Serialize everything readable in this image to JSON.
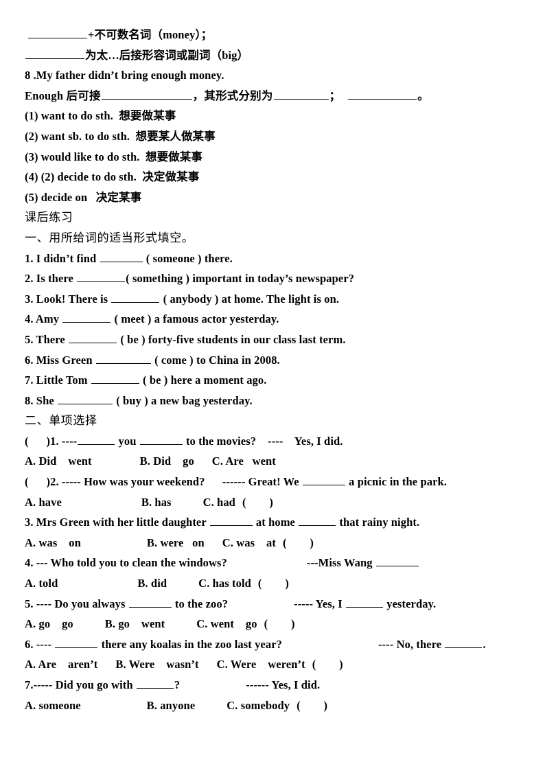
{
  "document": {
    "title": "English grammar worksheet page",
    "text_color": "#000000",
    "background_color": "#ffffff"
  },
  "notes": {
    "line1_suffix": "+不可数名词（money）；",
    "line2_suffix": "为太…后接形容词或副词（big）",
    "line3": "8 .My father didn’t bring enough money.",
    "line4_a": "Enough 后可接",
    "line4_b": "，其形式分别为",
    "line4_c": "；",
    "line4_d": "。",
    "items": [
      "(1) want to do sth.  想要做某事",
      "(2) want sb. to do sth.  想要某人做某事",
      "(3) would like to do sth.  想要做某事",
      "(4) (2) decide to do sth.  决定做某事",
      "(5) decide on   决定某事"
    ],
    "practice_heading": "课后练习"
  },
  "section_one": {
    "heading": "一、用所给词的适当形式填空。",
    "questions": [
      {
        "num": "1.",
        "before": " I didn’t find ",
        "after": " ( someone ) there."
      },
      {
        "num": "2.",
        "before": " Is there ",
        "after": "( something ) important in today’s newspaper?"
      },
      {
        "num": "3.",
        "before": " Look! There is ",
        "after": " ( anybody ) at home. The light is on."
      },
      {
        "num": "4.",
        "before": " Amy ",
        "after": " ( meet ) a famous actor yesterday."
      },
      {
        "num": "5.",
        "before": " There ",
        "after": " ( be ) forty-five students in our class last term."
      },
      {
        "num": "6.",
        "before": " Miss Green ",
        "after": " ( come ) to China in 2008."
      },
      {
        "num": "7.",
        "before": " Little Tom ",
        "after": " ( be ) here a moment ago."
      },
      {
        "num": "8.",
        "before": " She ",
        "after": " ( buy ) a new bag yesterday."
      }
    ]
  },
  "section_two": {
    "heading": "二、单项选择",
    "q1": {
      "lead": "(",
      "lead_close": ")1. ----",
      "mid": " you ",
      "tail": " to the movies?    ----    Yes, I did.",
      "options": "A. Did    went",
      "options_b": "B. Did    go",
      "options_c": "C. Are   went"
    },
    "q2": {
      "lead": "(",
      "lead_close": ")2. ----- How was your weekend?      ------ Great! We ",
      "tail": " a picnic in the park.",
      "options": "A. have",
      "options_b": "B. has",
      "options_c": "C. had",
      "answer_box": "(        )"
    },
    "q3": {
      "text_a": "3. Mrs Green with her little daughter ",
      "text_b": " at home ",
      "text_c": " that rainy night.",
      "options": "A. was    on",
      "options_b": "B. were   on",
      "options_c": "C. was    at",
      "answer_box": "(        )"
    },
    "q4": {
      "text_a": "4. --- Who told you to clean the windows?",
      "text_b": "---Miss Wang ",
      "options": "A. told",
      "options_b": "B. did",
      "options_c": "C. has told",
      "answer_box": "(        )"
    },
    "q5": {
      "text_a": "5. ---- Do you always ",
      "text_b": " to the zoo?",
      "text_c": "----- Yes, I ",
      "text_d": " yesterday.",
      "options": "A. go    go",
      "options_b": "B. go    went",
      "options_c": "C. went    go",
      "answer_box": "(        )"
    },
    "q6": {
      "text_a": "6. ---- ",
      "text_b": " there any koalas in the zoo last year?",
      "text_c": "---- No, there ",
      "text_d": ".",
      "options": "A. Are    aren’t",
      "options_b": "B. Were    wasn’t",
      "options_c": "C. Were    weren’t",
      "answer_box": "(        )"
    },
    "q7": {
      "text_a": "7.----- Did you go with ",
      "text_b": "?",
      "text_c": "------ Yes, I did.",
      "options": "A. someone",
      "options_b": "B. anyone",
      "options_c": "C. somebody",
      "answer_box": "(        )"
    }
  }
}
